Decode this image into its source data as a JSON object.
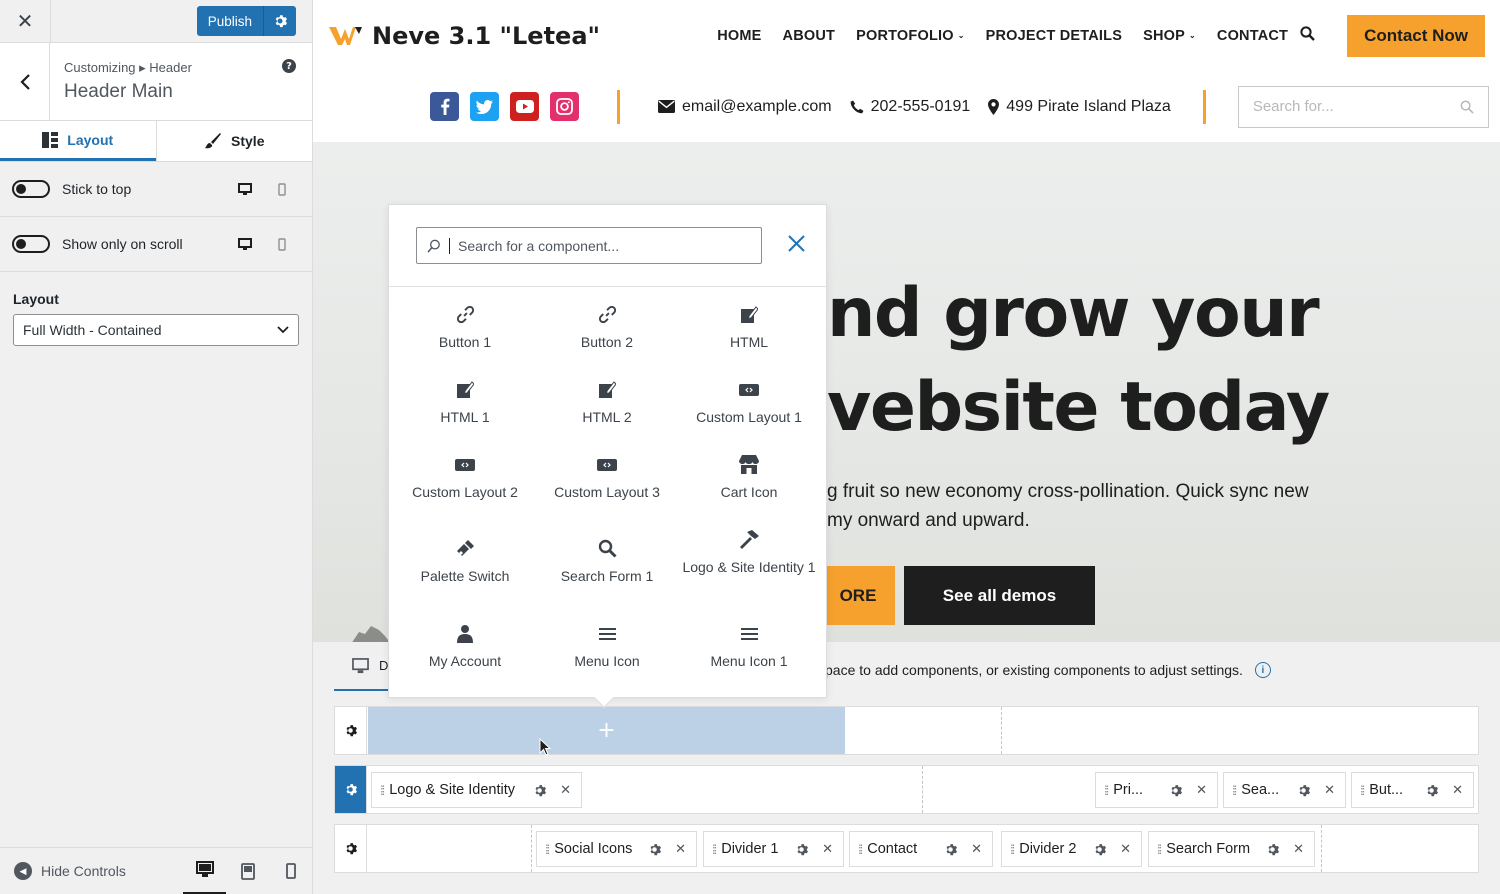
{
  "sidebar": {
    "close_label": "✕",
    "publish_label": "Publish",
    "breadcrumb": "Customizing ▸ Header",
    "section_title": "Header Main",
    "help_label": "?",
    "tabs": [
      {
        "label": "Layout",
        "icon": "layout-icon",
        "active": true
      },
      {
        "label": "Style",
        "icon": "brush-icon",
        "active": false
      }
    ],
    "toggles": [
      {
        "label": "Stick to top",
        "on": false
      },
      {
        "label": "Show only on scroll",
        "on": false
      }
    ],
    "layout_label": "Layout",
    "layout_value": "Full Width - Contained",
    "footer": {
      "hide_controls_label": "Hide Controls",
      "active_device": "desktop"
    }
  },
  "site": {
    "logo_text": "Neve 3.1 \"Letea\"",
    "nav": [
      {
        "label": "HOME",
        "caret": false
      },
      {
        "label": "ABOUT",
        "caret": false
      },
      {
        "label": "PORTOFOLIO",
        "caret": true
      },
      {
        "label": "PROJECT DETAILS",
        "caret": false
      },
      {
        "label": "SHOP",
        "caret": true
      },
      {
        "label": "CONTACT",
        "caret": false
      }
    ],
    "cta_label": "Contact Now",
    "socials": [
      {
        "name": "facebook",
        "color": "#3b5998"
      },
      {
        "name": "twitter",
        "color": "#1da1f2"
      },
      {
        "name": "youtube",
        "color": "#cd201f"
      },
      {
        "name": "instagram",
        "color": "#e1306c"
      }
    ],
    "contact": {
      "email": "email@example.com",
      "phone": "202-555-0191",
      "address": "499 Pirate Island Plaza"
    },
    "search_placeholder": "Search for...",
    "accent_color": "#f6a02d",
    "hero": {
      "heading_line1": "nd grow your",
      "heading_line2": "vebsite today",
      "text_line1": "g fruit so new economy cross-pollination. Quick sync new",
      "text_line2": "my onward and upward.",
      "btn1_label": "ORE",
      "btn2_label": "See all demos"
    }
  },
  "builder": {
    "tab_label": "D",
    "hint": "pace to add components, or existing components to adjust settings.",
    "info_label": "i",
    "add_label": "+",
    "rows": [
      {
        "chips": []
      },
      {
        "chips": [
          {
            "label": "Logo & Site Identity"
          },
          {
            "label": "Pri..."
          },
          {
            "label": "Sea..."
          },
          {
            "label": "But..."
          }
        ]
      },
      {
        "chips": [
          {
            "label": "Social Icons"
          },
          {
            "label": "Divider 1"
          },
          {
            "label": "Contact"
          },
          {
            "label": "Divider 2"
          },
          {
            "label": "Search Form"
          }
        ]
      }
    ]
  },
  "picker": {
    "search_placeholder": "Search for a component...",
    "components": [
      {
        "label": "Button 1",
        "icon": "link-icon"
      },
      {
        "label": "Button 2",
        "icon": "link-icon"
      },
      {
        "label": "HTML",
        "icon": "edit-icon"
      },
      {
        "label": "HTML 1",
        "icon": "edit-icon"
      },
      {
        "label": "HTML 2",
        "icon": "edit-icon"
      },
      {
        "label": "Custom Layout 1",
        "icon": "embed-icon"
      },
      {
        "label": "Custom Layout 2",
        "icon": "embed-icon"
      },
      {
        "label": "Custom Layout 3",
        "icon": "embed-icon"
      },
      {
        "label": "Cart Icon",
        "icon": "store-icon"
      },
      {
        "label": "Palette Switch",
        "icon": "art-icon"
      },
      {
        "label": "Search Form 1",
        "icon": "search-icon"
      },
      {
        "label": "Logo & Site Identity 1",
        "icon": "hammer-icon"
      },
      {
        "label": "My Account",
        "icon": "user-icon"
      },
      {
        "label": "Menu Icon",
        "icon": "menu-icon"
      },
      {
        "label": "Menu Icon 1",
        "icon": "menu-icon"
      }
    ]
  }
}
